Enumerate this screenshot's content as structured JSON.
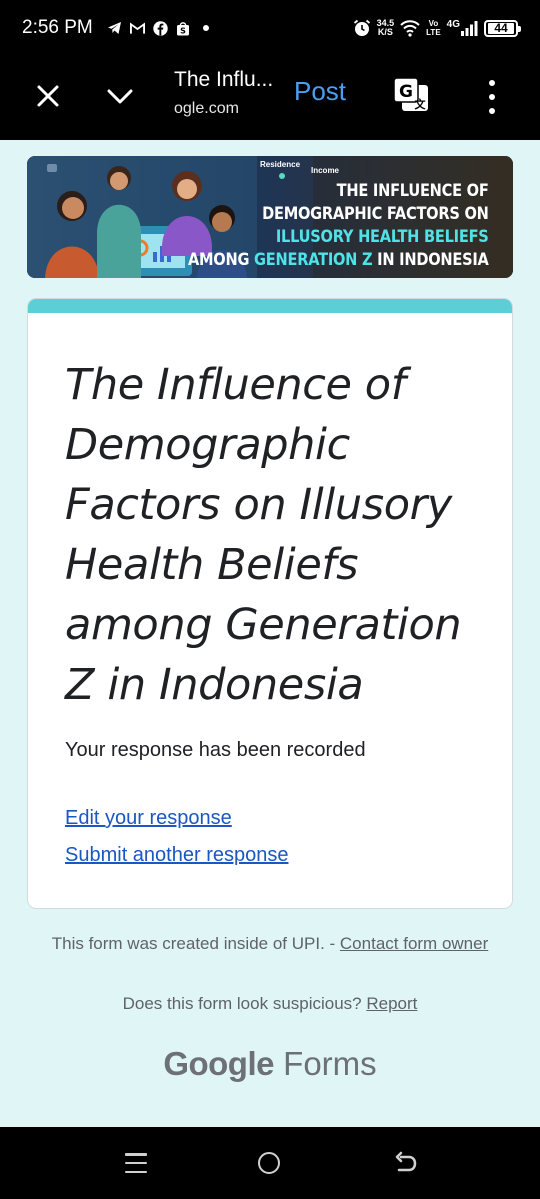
{
  "status_bar": {
    "time": "2:56 PM",
    "net_speed_value": "34.5",
    "net_speed_unit": "K/S",
    "volte_top": "Vo",
    "volte_bottom": "LTE",
    "network": "4G",
    "battery": "44",
    "icons": [
      "telegram-icon",
      "gmail-icon",
      "facebook-icon",
      "shopee-icon",
      "dot-icon",
      "alarm-icon",
      "wifi-icon",
      "signal-icon",
      "battery-icon"
    ]
  },
  "toolbar": {
    "title": "The Influ...",
    "url": "ogle.com",
    "post_label": "Post",
    "icons": [
      "close-icon",
      "chevron-down-icon",
      "translate-icon",
      "more-vert-icon"
    ]
  },
  "banner": {
    "chips": [
      "Residence",
      "Income"
    ],
    "line1": "The Influence of",
    "line2": "Demographic Factors on",
    "line3": "Illusory Health Beliefs",
    "line4_a": "Among ",
    "line4_b": "Generation Z",
    "line4_c": " in Indonesia"
  },
  "form": {
    "title": "The Influence of Demographic Factors on Illusory Health Beliefs among Generation Z in Indonesia",
    "response_message": "Your response has been recorded",
    "edit_link": "Edit your response",
    "submit_another_link": "Submit another response"
  },
  "footer": {
    "created_text": "This form was created inside of UPI. - ",
    "contact_link": "Contact form owner",
    "suspicious_text": "Does this form look suspicious? ",
    "report_link": "Report",
    "logo_google": "Google",
    "logo_forms": " Forms"
  },
  "colors": {
    "accent": "#5ccfd6",
    "page_bg": "#e0f5f6",
    "link": "#1a56c4",
    "post_blue": "#4a9ff5"
  }
}
